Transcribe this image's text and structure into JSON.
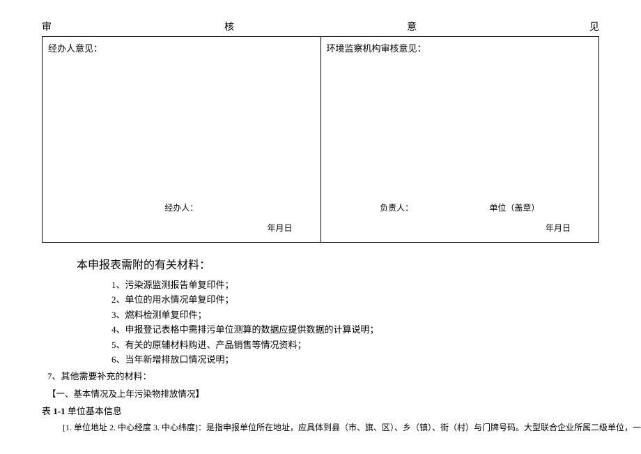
{
  "header": {
    "c1": "审",
    "c2": "核",
    "c3": "意",
    "c4": "见"
  },
  "review": {
    "left": {
      "title": "经办人意见：",
      "signer": "经办人：",
      "date": "年月日"
    },
    "right": {
      "title": "环境监察机构审核意见：",
      "signer1": "负责人：",
      "signer2": "单位（盖章）",
      "date": "年月日"
    }
  },
  "attachments": {
    "title": "本申报表需附的有关材料：",
    "items": [
      "1、污染源监测报告单复印件；",
      "2、单位的用水情况单复印件；",
      "3、燃料检测单复印件；",
      "4、申报登记表格中需排污单位测算的数据应提供数据的计算说明；",
      "5、有关的原辅材料购进、产品销售等情况资料；",
      "6、当年新增排放口情况说明；"
    ],
    "item7": "7、其他需要补充的材料："
  },
  "section": {
    "label": "【一、基本情况及上年污染物排放情况】",
    "table_prefix": "表",
    "table_num": " 1-1 ",
    "table_name": "单位基本信息",
    "footnote": "[1. 单位地址 2. 中心经度 3. 中心纬度]：是指申报单位所在地址，应具体到县（市、旗、区）、乡（镇）、街（村）与门牌号码。大型联合企业所属二级单位，一"
  }
}
